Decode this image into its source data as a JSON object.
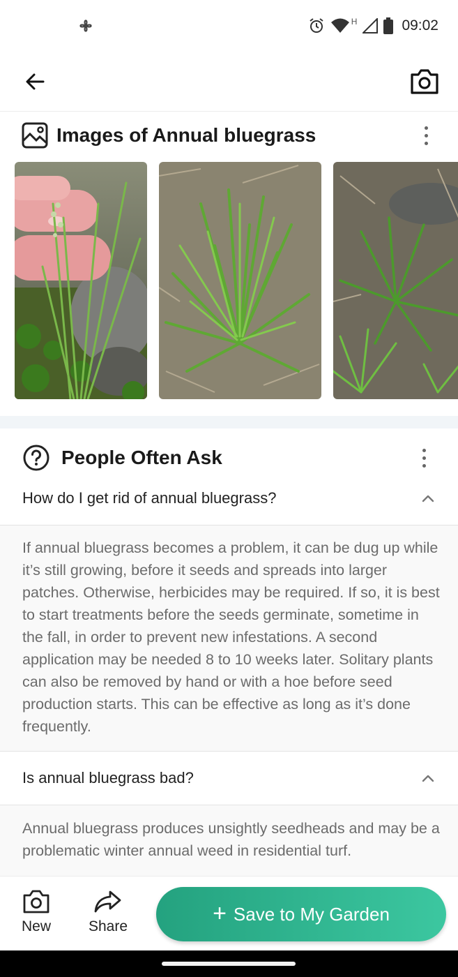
{
  "status_bar": {
    "time": "09:02",
    "network_label": "H",
    "icons": [
      "fan-icon",
      "alarm-icon",
      "wifi-icon",
      "signal-icon",
      "battery-icon"
    ]
  },
  "app_bar": {
    "icons": [
      "back-arrow-icon",
      "camera-icon"
    ]
  },
  "images_section": {
    "title": "Images of Annual bluegrass",
    "icons": [
      "gallery-icon",
      "more-vert-icon"
    ],
    "images": [
      {
        "name": "annual-bluegrass-photo-1",
        "description": "fingers holding grass stem with seedhead"
      },
      {
        "name": "annual-bluegrass-photo-2",
        "description": "clump of green grass"
      },
      {
        "name": "annual-bluegrass-photo-3",
        "description": "grass tuft in muddy soil"
      }
    ]
  },
  "faq_section": {
    "title": "People Often Ask",
    "icons": [
      "help-circle-icon",
      "more-vert-icon",
      "chevron-up-icon"
    ],
    "items": [
      {
        "question": "How do I get rid of annual bluegrass?",
        "answer": "If annual bluegrass becomes a problem, it can be dug up while it’s still growing, before it seeds and spreads into larger patches. Otherwise, herbicides may be required. If so, it is best to start treatments before the seeds germinate, sometime in the fall, in order to prevent new infestations. A second application may be needed 8 to 10 weeks later. Solitary plants can also be removed by hand or with a hoe before seed production starts. This can be effective as long as it’s done frequently.",
        "expanded": true
      },
      {
        "question": "Is annual bluegrass bad?",
        "answer": "Annual bluegrass produces unsightly seedheads and may be a problematic winter annual weed in residential turf.",
        "expanded": true
      }
    ]
  },
  "bottom_bar": {
    "new_label": "New",
    "share_label": "Share",
    "save_label": "Save to My Garden",
    "save_plus": "+",
    "accent_color": "#2eb48f"
  }
}
